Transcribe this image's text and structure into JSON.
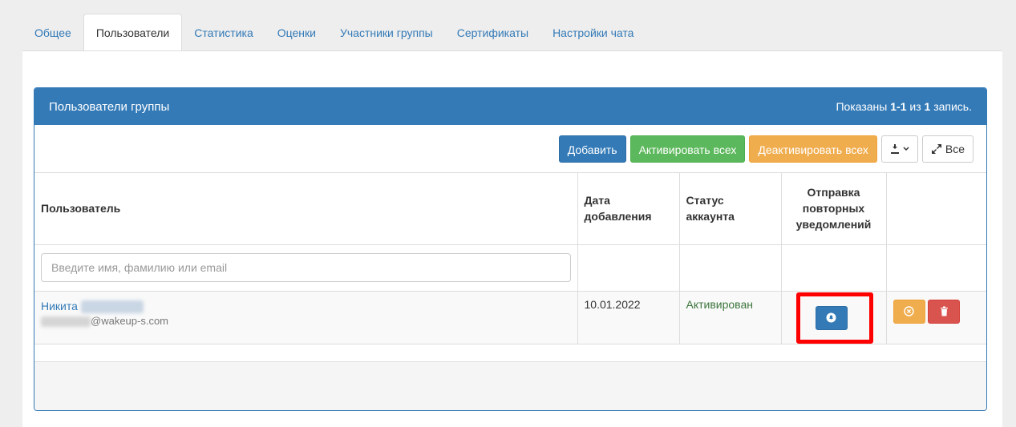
{
  "tabs": [
    "Общее",
    "Пользователи",
    "Статистика",
    "Оценки",
    "Участники группы",
    "Сертификаты",
    "Настройки чата"
  ],
  "active_tab": "Пользователи",
  "panel": {
    "title": "Пользователи группы",
    "summary_prefix": "Показаны ",
    "summary_range": "1-1",
    "summary_mid": " из ",
    "summary_total": "1",
    "summary_suffix": " запись."
  },
  "toolbar": {
    "add_label": "Добавить",
    "activate_all_label": "Активировать всех",
    "deactivate_all_label": "Деактивировать всех",
    "export_icon": "export-icon",
    "expand_label": "Все"
  },
  "table": {
    "headers": {
      "user": "Пользователь",
      "date": "Дата добавления",
      "status": "Статус аккаунта",
      "notify": "Отправка повторных уведомлений"
    },
    "search_placeholder": "Введите имя, фамилию или email",
    "rows": [
      {
        "first_name": "Никита",
        "email_domain": "@wakeup-s.com",
        "date": "10.01.2022",
        "status": "Активирован"
      }
    ]
  },
  "colors": {
    "primary": "#337ab7",
    "success": "#5cb85c",
    "warning": "#f0ad4e",
    "danger": "#d9534f",
    "highlight": "#ff0000"
  }
}
